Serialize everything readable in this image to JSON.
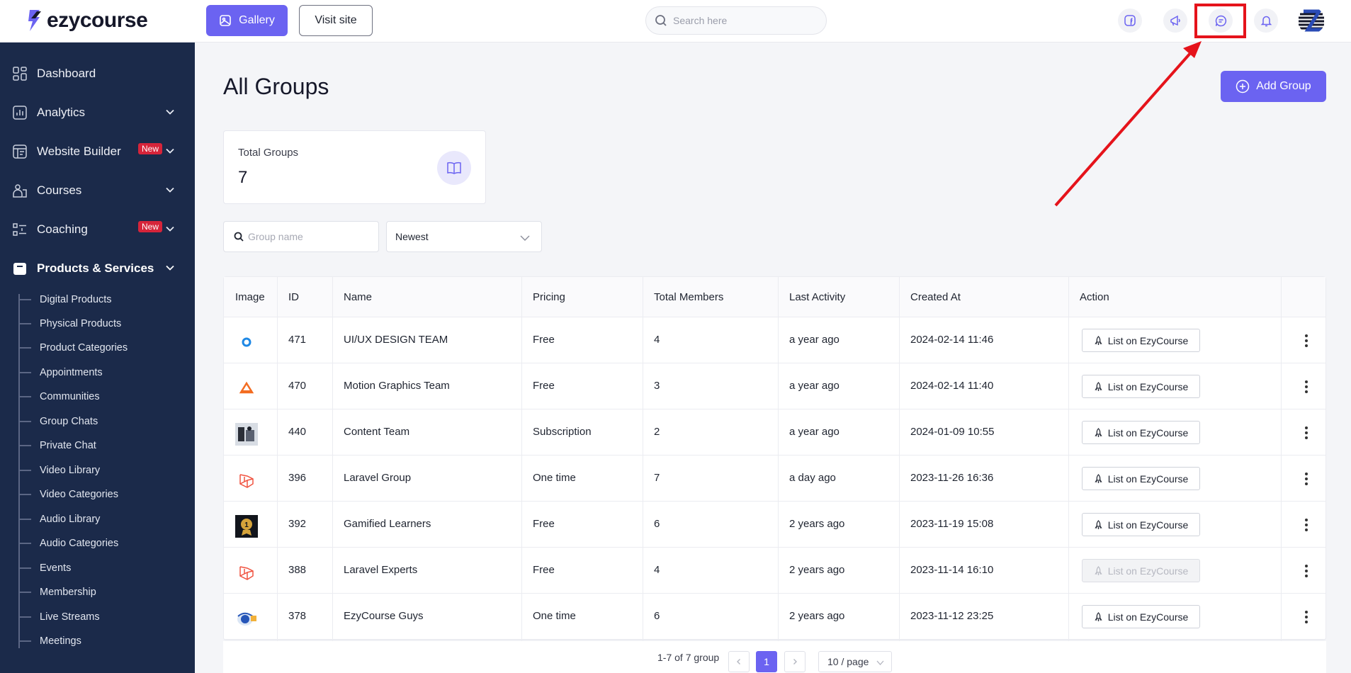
{
  "brand": {
    "name": "ezycourse",
    "accent": "#6b63f1",
    "sidebar_bg": "#1b2a4a"
  },
  "topbar": {
    "gallery_label": "Gallery",
    "visit_label": "Visit site",
    "search_placeholder": "Search here",
    "icons": [
      "facebook-icon",
      "megaphone-icon",
      "chat-icon",
      "bell-icon"
    ]
  },
  "sidebar": {
    "items": [
      {
        "label": "Dashboard"
      },
      {
        "label": "Analytics"
      },
      {
        "label": "Website Builder",
        "badge": "New"
      },
      {
        "label": "Courses"
      },
      {
        "label": "Coaching",
        "badge": "New"
      },
      {
        "label": "Products & Services"
      }
    ],
    "sub_items": [
      "Digital Products",
      "Physical Products",
      "Product Categories",
      "Appointments",
      "Communities",
      "Group Chats",
      "Private Chat",
      "Video Library",
      "Video Categories",
      "Audio Library",
      "Audio Categories",
      "Events",
      "Membership",
      "Live Streams",
      "Meetings"
    ]
  },
  "main": {
    "title": "All Groups",
    "add_label": "Add Group",
    "stat": {
      "label": "Total Groups",
      "value": "7"
    },
    "filter": {
      "placeholder": "Group name",
      "sort": "Newest"
    },
    "columns": [
      "Image",
      "ID",
      "Name",
      "Pricing",
      "Total Members",
      "Last Activity",
      "Created At",
      "Action"
    ],
    "rows": [
      {
        "id": "471",
        "name": "UI/UX DESIGN TEAM",
        "pricing": "Free",
        "members": "4",
        "activity": "a year ago",
        "created": "2024-02-14 11:46",
        "action": "List on EzyCourse",
        "disabled": false
      },
      {
        "id": "470",
        "name": "Motion Graphics Team",
        "pricing": "Free",
        "members": "3",
        "activity": "a year ago",
        "created": "2024-02-14 11:40",
        "action": "List on EzyCourse",
        "disabled": false
      },
      {
        "id": "440",
        "name": "Content Team",
        "pricing": "Subscription",
        "members": "2",
        "activity": "a year ago",
        "created": "2024-01-09 10:55",
        "action": "List on EzyCourse",
        "disabled": false
      },
      {
        "id": "396",
        "name": "Laravel Group",
        "pricing": "One time",
        "members": "7",
        "activity": "a day ago",
        "created": "2023-11-26 16:36",
        "action": "List on EzyCourse",
        "disabled": false
      },
      {
        "id": "392",
        "name": "Gamified Learners",
        "pricing": "Free",
        "members": "6",
        "activity": "2 years ago",
        "created": "2023-11-19 15:08",
        "action": "List on EzyCourse",
        "disabled": false
      },
      {
        "id": "388",
        "name": "Laravel Experts",
        "pricing": "Free",
        "members": "4",
        "activity": "2 years ago",
        "created": "2023-11-14 16:10",
        "action": "List on EzyCourse",
        "disabled": true
      },
      {
        "id": "378",
        "name": "EzyCourse Guys",
        "pricing": "One time",
        "members": "6",
        "activity": "2 years ago",
        "created": "2023-11-12 23:25",
        "action": "List on EzyCourse",
        "disabled": false
      }
    ],
    "pagination": {
      "summary": "1-7 of 7 group",
      "current": "1",
      "page_size": "10 / page"
    }
  }
}
